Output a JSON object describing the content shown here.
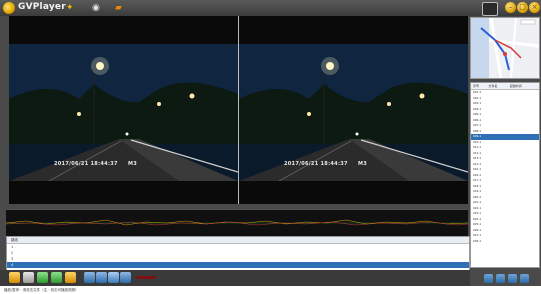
{
  "app": {
    "title": "GVPlayer"
  },
  "titlebar": {
    "icons": [
      "settings-icon",
      "record-icon",
      "folder-icon"
    ],
    "right_label": "",
    "controls": [
      "minimize-icon",
      "maximize-icon",
      "close-icon"
    ]
  },
  "video": {
    "left": {
      "timestamp": "2017/06/21  18:44:37",
      "channel": "M3"
    },
    "right": {
      "timestamp": "2017/06/21  18:44:37",
      "channel": "M3"
    }
  },
  "timeline": {
    "legend": [
      "",
      "",
      ""
    ]
  },
  "table": {
    "headers": [
      "路线",
      "",
      "",
      "",
      ""
    ],
    "rows": [
      [
        "1",
        "",
        "",
        "",
        ""
      ],
      [
        "2",
        "",
        "",
        "",
        ""
      ],
      [
        "3",
        "",
        "",
        "",
        ""
      ],
      [
        "4",
        "",
        "",
        "",
        ""
      ]
    ]
  },
  "status": {
    "text": "播放/暂停：请双击文件（注：双击可播放视频）"
  },
  "list": {
    "headers": [
      "序号",
      "文件名",
      "起始时间",
      ""
    ],
    "rows": [
      [
        "001-1",
        "",
        "",
        ""
      ],
      [
        "002-1",
        "",
        "",
        ""
      ],
      [
        "003-1",
        "",
        "",
        ""
      ],
      [
        "004-1",
        "",
        "",
        ""
      ],
      [
        "005-1",
        "",
        "",
        ""
      ],
      [
        "006-1",
        "",
        "",
        ""
      ],
      [
        "007-1",
        "",
        "",
        ""
      ],
      [
        "008-1",
        "",
        "",
        ""
      ],
      [
        "009-1",
        "",
        "",
        ""
      ],
      [
        "010-1",
        "",
        "",
        ""
      ],
      [
        "011-1",
        "",
        "",
        ""
      ],
      [
        "012-1",
        "",
        "",
        ""
      ],
      [
        "013-1",
        "",
        "",
        ""
      ],
      [
        "014-1",
        "",
        "",
        ""
      ],
      [
        "015-1",
        "",
        "",
        ""
      ],
      [
        "016-1",
        "",
        "",
        ""
      ],
      [
        "017-1",
        "",
        "",
        ""
      ],
      [
        "018-1",
        "",
        "",
        ""
      ],
      [
        "019-1",
        "",
        "",
        ""
      ],
      [
        "020-1",
        "",
        "",
        ""
      ],
      [
        "021-1",
        "",
        "",
        ""
      ],
      [
        "022-1",
        "",
        "",
        ""
      ],
      [
        "023-1",
        "",
        "",
        ""
      ],
      [
        "024-1",
        "",
        "",
        ""
      ],
      [
        "025-1",
        "",
        "",
        ""
      ],
      [
        "026-1",
        "",
        "",
        ""
      ],
      [
        "027-1",
        "",
        "",
        ""
      ],
      [
        "028-1",
        "",
        "",
        ""
      ]
    ]
  },
  "colors": {
    "accent": "#e2a400",
    "selection": "#2f6fb5",
    "background": "#4a4a4a"
  }
}
